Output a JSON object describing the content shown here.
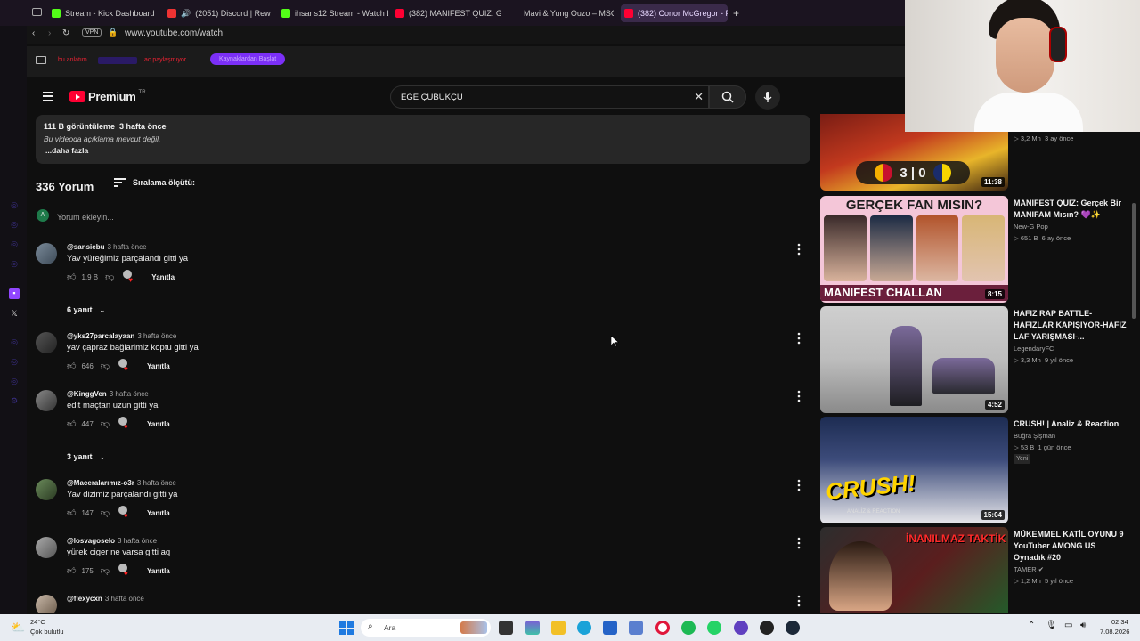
{
  "browser": {
    "tabs": [
      {
        "label": "Stream - Kick Dashboard",
        "color": "#53fc18"
      },
      {
        "label": "(2051) Discord | Rew J",
        "color": "#ff4444"
      },
      {
        "label": "ihsans12 Stream - Watch L",
        "color": "#53fc18"
      },
      {
        "label": "(382) MANIFEST QUIZ: Ge",
        "color": "#ff0033"
      },
      {
        "label": "Mavi & Yung Ouzo – MSG",
        "color": ""
      },
      {
        "label": "(382) Conor McGregor - Fr",
        "color": "#ff0033"
      }
    ],
    "vpn": "VPN",
    "url": "www.youtube.com/watch"
  },
  "twitch_bar": {
    "label1": "bu anlatım",
    "label2": "ac paylaşmıyor",
    "chip": "Kaynaklardan Başlat"
  },
  "youtube": {
    "logo": "Premium",
    "logo_sup": "TR",
    "search_value": "EGE ÇUBUKÇU",
    "description": {
      "stats": "111 B görüntüleme  3 hafta önce",
      "empty": "Bu videoda açıklama mevcut değil.",
      "more": "...daha fazla"
    },
    "comments_header": {
      "count": "336 Yorum",
      "sort": "Sıralama ölçütü:",
      "add_placeholder": "Yorum ekleyin...",
      "user_initial": "A"
    },
    "reply_label": "Yanıtla",
    "comments": [
      {
        "author": "@sansiebu",
        "time": "3 hafta önce",
        "text": "Yav yüreğimiz parçalandı gitti ya",
        "likes": "1,9 B",
        "replies": "6 yanıt"
      },
      {
        "author": "@yks27parcalayaan",
        "time": "3 hafta önce",
        "text": "yav çapraz bağlarimiz koptu gitti ya",
        "likes": "646"
      },
      {
        "author": "@KinggVen",
        "time": "3 hafta önce",
        "text": "edit maçtan uzun gitti ya",
        "likes": "447",
        "replies": "3 yanıt"
      },
      {
        "author": "@Maceralarımız-o3r",
        "time": "3 hafta önce",
        "text": "Yav dizimiz parçalandı gitti ya",
        "likes": "147"
      },
      {
        "author": "@losvagoselo",
        "time": "3 hafta önce",
        "text": "yürek ciger ne varsa gitti aq",
        "likes": "175"
      },
      {
        "author": "@flexycxn",
        "time": "3 hafta önce",
        "text": "",
        "likes": ""
      }
    ],
    "sidebar": [
      {
        "duration": "11:38",
        "meta1": "3,2 Mn  3 ay önce",
        "score": "3 | 0"
      },
      {
        "title": "MANIFEST QUIZ: Gerçek Bir MANIFAM Mısın? 💜✨",
        "channel": "New-G Pop",
        "meta": "651 B  6 ay önce",
        "duration": "8:15",
        "thumb_top": "GERÇEK FAN MISIN?",
        "thumb_bottom": "MANIFEST CHALLAN"
      },
      {
        "title": "HAFIZ RAP BATTLE-HAFIZLAR KAPIŞIYOR-HAFIZ LAF YARIŞMASI-...",
        "channel": "LegendaryFC",
        "meta": "3,3 Mn  9 yıl önce",
        "duration": "4:52"
      },
      {
        "title": "CRUSH! | Analiz & Reaction",
        "channel": "Buğra Şişman",
        "meta": "53 B  1 gün önce",
        "badge": "Yeni",
        "duration": "15:04",
        "thumb_text": "CRUSH!",
        "thumb_sub": "ANALİZ & REACTION"
      },
      {
        "title": "MÜKEMMEL KATİL OYUNU 9 YouTuber AMONG US Oynadık #20",
        "channel": "TAMER",
        "meta": "1,2 Mn  5 yıl önce",
        "thumb_text": "İNANILMAZ TAKTİK"
      }
    ]
  },
  "taskbar": {
    "weather_temp": "24°C",
    "weather_desc": "Çok bulutlu",
    "search": "Ara",
    "time": "02:34",
    "date": "7.08.2026"
  }
}
